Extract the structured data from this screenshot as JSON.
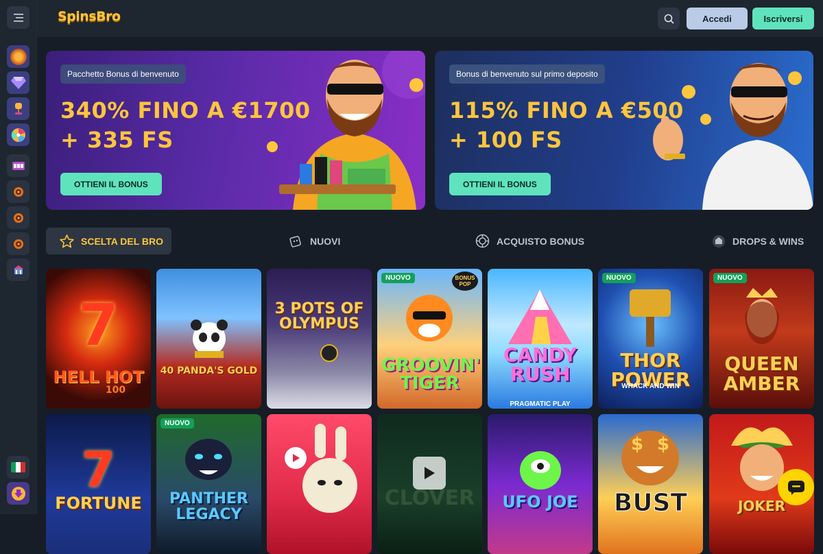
{
  "header": {
    "logo": "SpinsBro",
    "login_label": "Accedi",
    "signup_label": "Iscriversi"
  },
  "sidebar": {
    "menu_icon": "hamburger-icon",
    "items": [
      {
        "icon": "coin-icon",
        "color": "#e08a1e"
      },
      {
        "icon": "diamond-icon",
        "color": "#8a6cf0"
      },
      {
        "icon": "trophy-icon",
        "color": "#c04aa0"
      },
      {
        "icon": "wheel-icon",
        "color": "#8a6cf0"
      },
      {
        "icon": "slot-icon",
        "color": "#c85adb"
      },
      {
        "icon": "roulette-icon",
        "color": "#e0731e"
      },
      {
        "icon": "roulette-icon",
        "color": "#e0731e"
      },
      {
        "icon": "roulette-icon",
        "color": "#e0731e"
      },
      {
        "icon": "casino-table-icon",
        "color": "#6a8fe0"
      }
    ],
    "language_flag": "italy-flag-icon",
    "download_icon": "download-icon"
  },
  "banners": [
    {
      "tag": "Pacchetto Bonus di benvenuto",
      "line1": "340% FINO A €1700",
      "line2": "+ 335 FS",
      "cta": "OTTIENI IL BONUS"
    },
    {
      "tag": "Bonus di benvenuto sul primo deposito",
      "line1": "115% FINO A €500",
      "line2": "+ 100 FS",
      "cta": "OTTIENI IL BONUS"
    }
  ],
  "tabs": [
    {
      "label": "SCELTA DEL BRO",
      "icon": "star-icon"
    },
    {
      "label": "NUOVI",
      "icon": "dice-icon"
    },
    {
      "label": "ACQUISTO BONUS",
      "icon": "chip-icon"
    },
    {
      "label": "DROPS & WINS",
      "icon": "drops-wins-icon"
    }
  ],
  "games_row1": [
    {
      "title": "HELL HOT",
      "sub": "100"
    },
    {
      "title": "40 PANDA'S GOLD",
      "sub": ""
    },
    {
      "title": "3 POTS OF OLYMPUS",
      "sub": ""
    },
    {
      "title": "GROOVIN' TIGER",
      "sub": "",
      "badge": "NUOVO",
      "corner": "BONUS POP"
    },
    {
      "title": "CANDY RUSH",
      "sub": "PRAGMATIC PLAY"
    },
    {
      "title": "THOR POWER",
      "sub": "WHACK AND WIN",
      "badge": "NUOVO"
    },
    {
      "title": "QUEEN AMBER",
      "sub": "",
      "badge": "NUOVO"
    }
  ],
  "games_row2": [
    {
      "title": "FORTUNE",
      "sub": ""
    },
    {
      "title": "PANTHER LEGACY",
      "sub": "",
      "badge": "NUOVO"
    },
    {
      "title": "",
      "sub": ""
    },
    {
      "title": "CLOVER",
      "sub": ""
    },
    {
      "title": "UFO JOE",
      "sub": ""
    },
    {
      "title": "BUST",
      "sub": ""
    },
    {
      "title": "JOKER",
      "sub": ""
    }
  ],
  "chat_icon": "chat-icon"
}
